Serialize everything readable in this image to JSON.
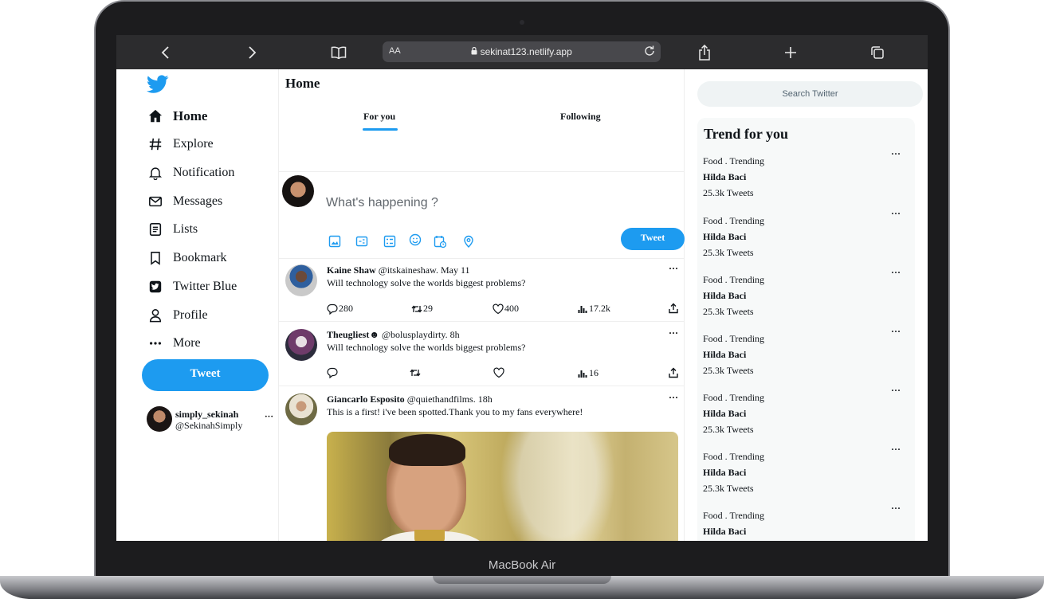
{
  "device": {
    "brand": "MacBook Air"
  },
  "browser": {
    "aa_label": "AA",
    "url": "sekinat123.netlify.app"
  },
  "sidebar": {
    "items": [
      {
        "label": "Home",
        "icon": "home-icon"
      },
      {
        "label": "Explore",
        "icon": "hashtag-icon"
      },
      {
        "label": "Notification",
        "icon": "bell-icon"
      },
      {
        "label": "Messages",
        "icon": "mail-icon"
      },
      {
        "label": "Lists",
        "icon": "list-icon"
      },
      {
        "label": "Bookmark",
        "icon": "bookmark-icon"
      },
      {
        "label": "Twitter Blue",
        "icon": "twitter-blue-icon"
      },
      {
        "label": "Profile",
        "icon": "person-icon"
      },
      {
        "label": "More",
        "icon": "more-icon"
      }
    ],
    "tweet_button": "Tweet",
    "account": {
      "name": "simply_sekinah",
      "handle": "@SekinahSimply",
      "more": "···"
    }
  },
  "main": {
    "title": "Home",
    "tabs": [
      {
        "label": "For you",
        "active": true
      },
      {
        "label": "Following",
        "active": false
      }
    ],
    "compose": {
      "placeholder": "What's happening ?",
      "button": "Tweet"
    },
    "tweets": [
      {
        "name": "Kaine Shaw",
        "meta": "@itskaineshaw. May 11",
        "text": "Will technology solve the worlds biggest problems?",
        "replies": "280",
        "retweets": "29",
        "likes": "400",
        "views": "17.2k",
        "more": "···"
      },
      {
        "name": "Theugliest",
        "emoji": "☻",
        "meta": "@bolusplaydirty. 8h",
        "text": "Will technology solve the worlds biggest problems?",
        "replies": "",
        "retweets": "",
        "likes": "",
        "views": "16",
        "more": "···"
      },
      {
        "name": "Giancarlo Esposito",
        "meta": "@quiethandfilms. 18h",
        "text": "This is a first! i've been spotted.Thank you to my fans everywhere!",
        "more": "···"
      }
    ]
  },
  "right": {
    "search_placeholder": "Search Twitter",
    "trends_title": "Trend for you",
    "trends": [
      {
        "category": "Food . Trending",
        "name": "Hilda Baci",
        "count": "25.3k Tweets",
        "more": "···"
      },
      {
        "category": "Food . Trending",
        "name": "Hilda Baci",
        "count": "25.3k Tweets",
        "more": "···"
      },
      {
        "category": "Food . Trending",
        "name": "Hilda Baci",
        "count": "25.3k Tweets",
        "more": "···"
      },
      {
        "category": "Food . Trending",
        "name": "Hilda Baci",
        "count": "25.3k Tweets",
        "more": "···"
      },
      {
        "category": "Food . Trending",
        "name": "Hilda Baci",
        "count": "25.3k Tweets",
        "more": "···"
      },
      {
        "category": "Food . Trending",
        "name": "Hilda Baci",
        "count": "25.3k Tweets",
        "more": "···"
      },
      {
        "category": "Food . Trending",
        "name": "Hilda Baci",
        "count": "",
        "more": "···"
      }
    ]
  },
  "colors": {
    "accent": "#1d9bf0",
    "text": "#0f1419",
    "browser_bar": "#2c2c2e"
  }
}
